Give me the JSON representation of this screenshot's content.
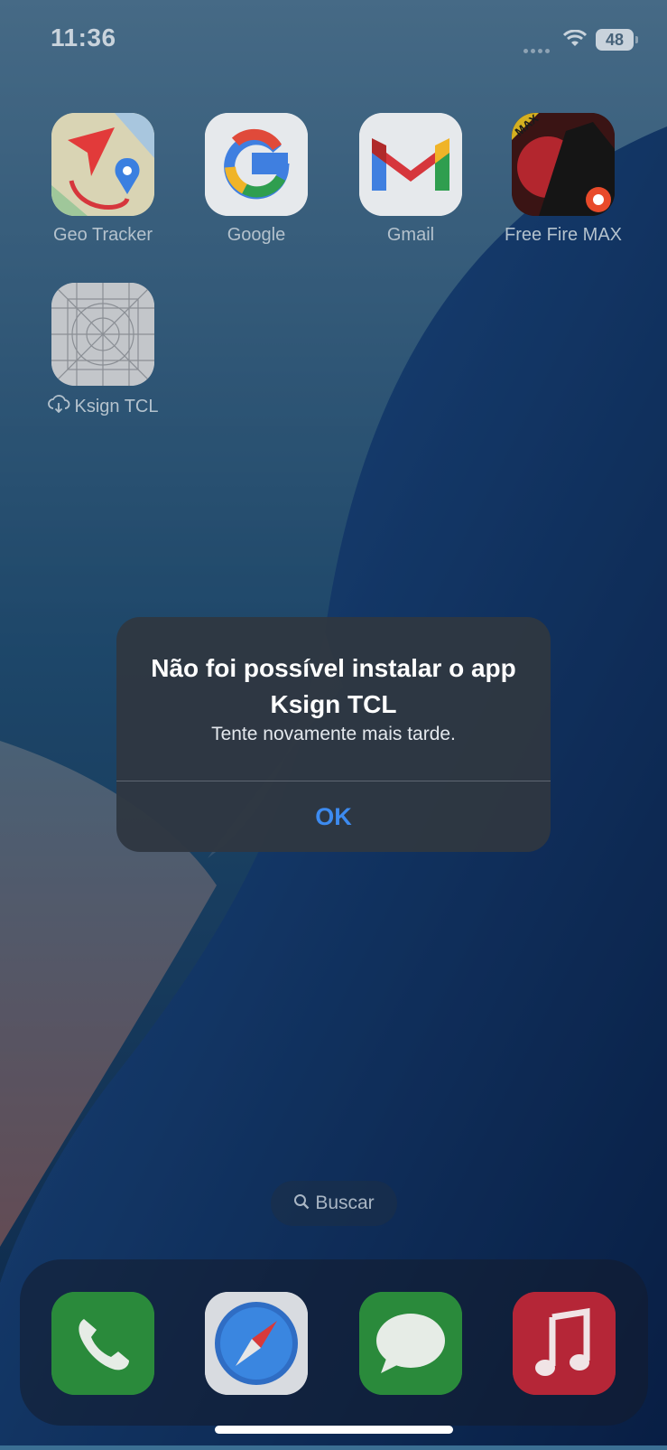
{
  "status_bar": {
    "time": "11:36",
    "battery": "48",
    "icons": [
      "cellular-signal-icon",
      "wifi-icon",
      "battery-icon"
    ]
  },
  "home_screen": {
    "apps": [
      {
        "label": "Geo Tracker",
        "icon": "geo-tracker-icon"
      },
      {
        "label": "Google",
        "icon": "google-icon"
      },
      {
        "label": "Gmail",
        "icon": "gmail-icon"
      },
      {
        "label": "Free Fire MAX",
        "icon": "free-fire-max-icon",
        "badge_text": "MAX"
      },
      {
        "label": "Ksign TCL",
        "icon": "app-placeholder-icon",
        "status_icon": "cloud-download-icon"
      }
    ],
    "search": {
      "label": "Buscar",
      "icon": "search-icon"
    },
    "dock": [
      {
        "name": "phone",
        "icon": "phone-icon"
      },
      {
        "name": "safari",
        "icon": "safari-compass-icon"
      },
      {
        "name": "messages",
        "icon": "messages-icon"
      },
      {
        "name": "music",
        "icon": "music-note-icon"
      }
    ]
  },
  "alert": {
    "title": "Não foi possível instalar o app Ksign TCL",
    "message": "Tente novamente mais tarde.",
    "button": "OK"
  },
  "colors": {
    "alert_background": "#2f3742",
    "alert_button_text": "#3d8bf0",
    "dim_overlay": "rgba(5,10,25,0.38)"
  }
}
